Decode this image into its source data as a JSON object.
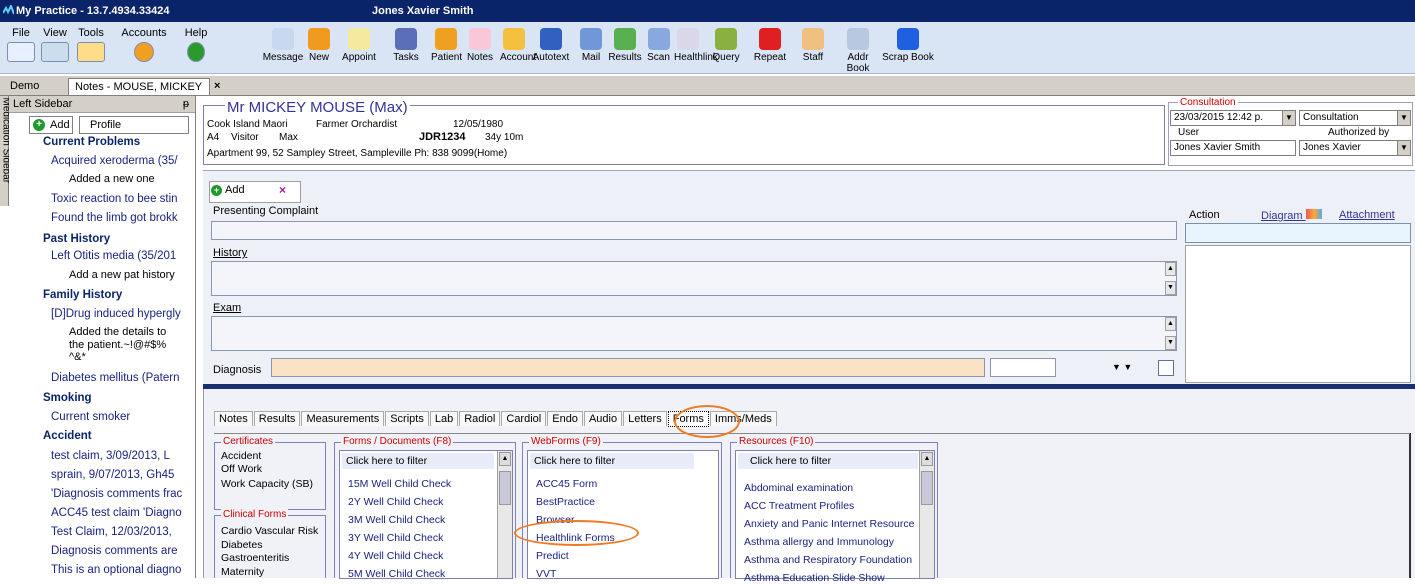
{
  "titlebar": {
    "app": "My Practice - 13.7.4934.33424",
    "user": "Jones Xavier Smith"
  },
  "menus": [
    {
      "label": "File",
      "icon": "file-icon"
    },
    {
      "label": "View",
      "icon": "view-icon"
    },
    {
      "label": "Tools",
      "icon": "tools-icon"
    },
    {
      "label": "Accounts",
      "icon": "accounts-icon"
    },
    {
      "label": "Help",
      "icon": "help-icon"
    }
  ],
  "toolbar": [
    "Message",
    "New",
    "Appoint",
    "Tasks",
    "Patient",
    "Notes",
    "Account",
    "Autotext",
    "Mail",
    "Results",
    "Scan",
    "Healthlink",
    "Query",
    "Repeat",
    "Staff",
    "Addr Book",
    "Scrap Book"
  ],
  "windowtabs": {
    "demo": "Demo",
    "notes": "Notes - MOUSE, MICKEY",
    "close": "×"
  },
  "sidebar": {
    "vertical": "Medication Sidebar",
    "title": "Left Sidebar",
    "pin": "ᵽ",
    "add": "Add",
    "profile": "Profile",
    "items": [
      {
        "t": "Current Problems",
        "k": "h"
      },
      {
        "t": "Acquired xeroderma (35/",
        "k": "c"
      },
      {
        "t": "Added a new one",
        "k": "s"
      },
      {
        "t": "Toxic reaction to bee stin",
        "k": "c"
      },
      {
        "t": "Found the limb got brokk",
        "k": "c"
      },
      {
        "t": "Past History",
        "k": "h"
      },
      {
        "t": "Left Otitis media (35/201",
        "k": "c"
      },
      {
        "t": "Add a new pat history",
        "k": "s"
      },
      {
        "t": "Family History",
        "k": "h"
      },
      {
        "t": "[D]Drug induced hypergly",
        "k": "c"
      },
      {
        "t": "Added the details to",
        "k": "s"
      },
      {
        "t": "the patient.~!@#$%",
        "k": "s"
      },
      {
        "t": "^&*",
        "k": "s"
      },
      {
        "t": "Diabetes mellitus (Patern",
        "k": "c"
      },
      {
        "t": "Smoking",
        "k": "h"
      },
      {
        "t": "Current smoker",
        "k": "c"
      },
      {
        "t": "Accident",
        "k": "h"
      },
      {
        "t": "test claim, 3/09/2013, L",
        "k": "c"
      },
      {
        "t": "sprain, 9/07/2013, Gh45",
        "k": "c"
      },
      {
        "t": "'Diagnosis comments frac",
        "k": "c"
      },
      {
        "t": "ACC45 test claim 'Diagno",
        "k": "c"
      },
      {
        "t": "Test Claim, 12/03/2013,",
        "k": "c"
      },
      {
        "t": "Diagnosis comments are",
        "k": "c"
      },
      {
        "t": "This is an optional diagno",
        "k": "c"
      }
    ]
  },
  "patient": {
    "name": "Mr MICKEY MOUSE (Max)",
    "ethnicity": "Cook Island Maori",
    "occupation": "Farmer Orchardist",
    "dob": "12/05/1980",
    "a4": "A4",
    "visitor": "Visitor",
    "max": "Max",
    "nhi": "JDR1234",
    "age": "34y 10m",
    "address": "Apartment 99, 52 Sampley Street, Sampleville  Ph: 838 9099(Home)"
  },
  "consultation": {
    "title": "Consultation",
    "datetime": "23/03/2015 12:42 p.",
    "type": "Consultation",
    "user_label": "User",
    "user": "Jones Xavier Smith",
    "auth_label": "Authorized by",
    "auth": "Jones Xavier"
  },
  "entry": {
    "add": "Add",
    "close": "×",
    "presenting": "Presenting Complaint",
    "history": "History",
    "exam": "Exam",
    "diagnosis": "Diagnosis",
    "action": "Action",
    "diagram": "Diagram",
    "attachment": "Attachment"
  },
  "bottomtabs": [
    "Notes",
    "Results",
    "Measurements",
    "Scripts",
    "Lab",
    "Radiol",
    "Cardiol",
    "Endo",
    "Audio",
    "Letters",
    "Forms",
    "Imms/Meds"
  ],
  "certificates": {
    "title": "Certificates",
    "items": [
      "Accident",
      "Off Work",
      "Work Capacity (SB)"
    ]
  },
  "clinical": {
    "title": "Clinical Forms",
    "items": [
      "Cardio Vascular Risk",
      "Diabetes",
      "Gastroenteritis",
      "Maternity"
    ]
  },
  "forms": {
    "title": "Forms / Documents (F8)",
    "filter": "Click here to filter",
    "items": [
      "15M Well Child Check",
      "2Y Well Child Check",
      "3M Well Child Check",
      "3Y Well Child Check",
      "4Y Well Child Check",
      "5M Well Child Check"
    ]
  },
  "webforms": {
    "title": "WebForms (F9)",
    "filter": "Click here to filter",
    "items": [
      "ACC45 Form",
      "BestPractice",
      "Browser",
      "Healthlink Forms",
      "Predict",
      "VVT"
    ]
  },
  "resources": {
    "title": "Resources (F10)",
    "filter": "Click here to filter",
    "items": [
      "Abdominal examination",
      "ACC Treatment Profiles",
      "Anxiety and Panic Internet Resource",
      "Asthma allergy and Immunology",
      "Asthma and Respiratory Foundation",
      "Asthma Education Slide Show"
    ]
  },
  "colors": {
    "titlebar": "#0a246a",
    "highlight": "#f07b22",
    "accent": "#333399"
  }
}
